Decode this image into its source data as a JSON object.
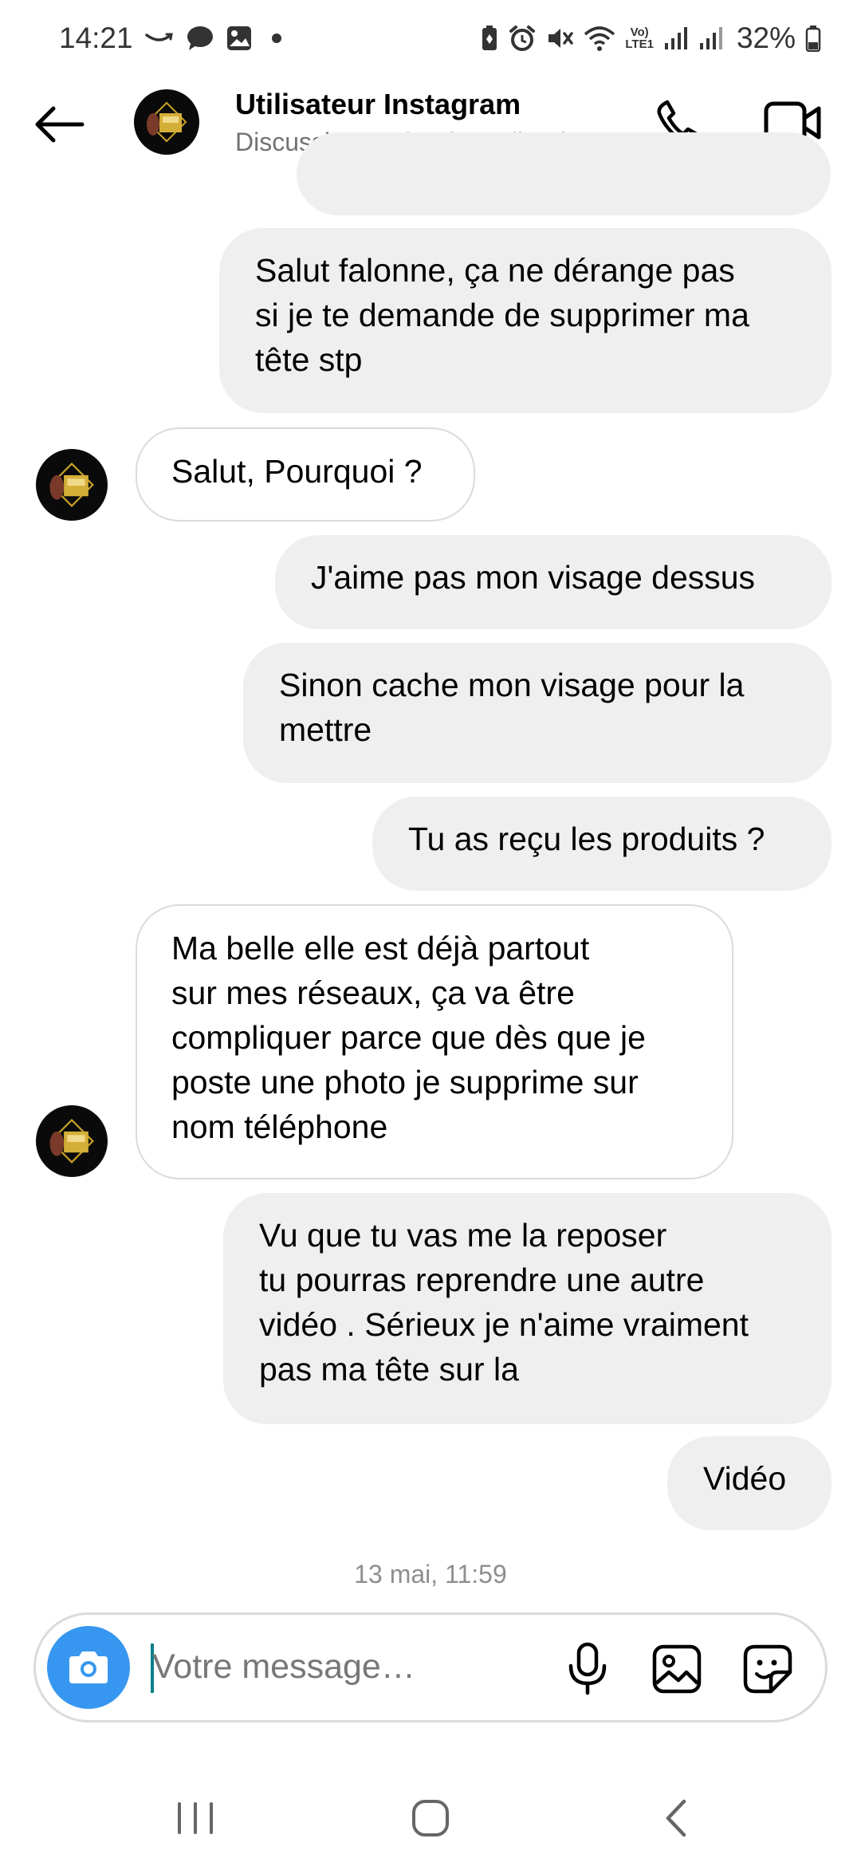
{
  "status_bar": {
    "time": "14:21",
    "battery": "32%",
    "network_label_top": "Vo)",
    "network_label_bottom": "LTE1",
    "left_icons": [
      "amazon-smile-icon",
      "chat-bubble-icon",
      "image-icon",
      "dot-icon"
    ],
    "right_icons": [
      "battery-saver-icon",
      "alarm-icon",
      "mute-icon",
      "wifi-icon",
      "signal-icon",
      "signal-icon",
      "battery-icon"
    ]
  },
  "header": {
    "title": "Utilisateur Instagram",
    "subtitle": "Discussion professionnelle • l…"
  },
  "messages": [
    {
      "side": "out",
      "text": "Salut falonne, ça ne dérange pas\nsi je te demande de supprimer ma\ntête stp"
    },
    {
      "side": "in",
      "text": "Salut, Pourquoi ?",
      "avatar": true
    },
    {
      "side": "out",
      "text": "J'aime pas mon visage dessus"
    },
    {
      "side": "out",
      "text": "Sinon cache mon visage pour la\nmettre"
    },
    {
      "side": "out",
      "text": "Tu as reçu les produits ?"
    },
    {
      "side": "in",
      "text": "Ma belle elle est déjà partout\nsur mes réseaux, ça va être\ncompliquer parce que dès que je\nposte une photo je supprime sur\nnom téléphone",
      "avatar": true
    },
    {
      "side": "out",
      "text": "Vu que tu vas me la reposer\ntu pourras reprendre une autre\nvidéo . Sérieux je n'aime vraiment\npas ma tête sur la"
    },
    {
      "side": "out",
      "text": "Vidéo"
    }
  ],
  "timestamp": "13 mai, 11:59",
  "composer": {
    "placeholder": "Votre message…",
    "value": ""
  },
  "colors": {
    "camera_button": "#3797f0",
    "outgoing_bubble": "#efefef",
    "incoming_border": "#dbdbdb",
    "subtitle_text": "#737373",
    "timestamp_text": "#8e8e8e"
  }
}
